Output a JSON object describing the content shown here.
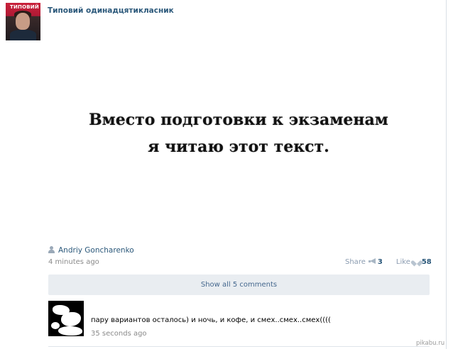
{
  "group": {
    "name": "Типовий одинадцятикласник",
    "logo_text": "ТИПОВИЙ"
  },
  "post": {
    "image_text": {
      "line1": "Вместо подготовки к экзаменам",
      "line2": "я читаю этот текст."
    },
    "author": "Andriy Goncharenko",
    "time": "4 minutes ago",
    "actions": {
      "share_label": "Share",
      "share_count": "3",
      "like_label": "Like",
      "like_count": "58"
    }
  },
  "comments": {
    "show_all_label": "Show all 5 comments",
    "items": [
      {
        "text": "пару вариантов осталось) и ночь, и кофе, и смех..смех..смех((((",
        "time": "35 seconds ago"
      }
    ]
  },
  "watermark": "pikabu.ru",
  "colors": {
    "link": "#2b587a",
    "meta": "#8a8a8a",
    "button_bg": "#e9edf1"
  },
  "icons": [
    "user-icon",
    "megaphone-icon",
    "heart-icon"
  ]
}
